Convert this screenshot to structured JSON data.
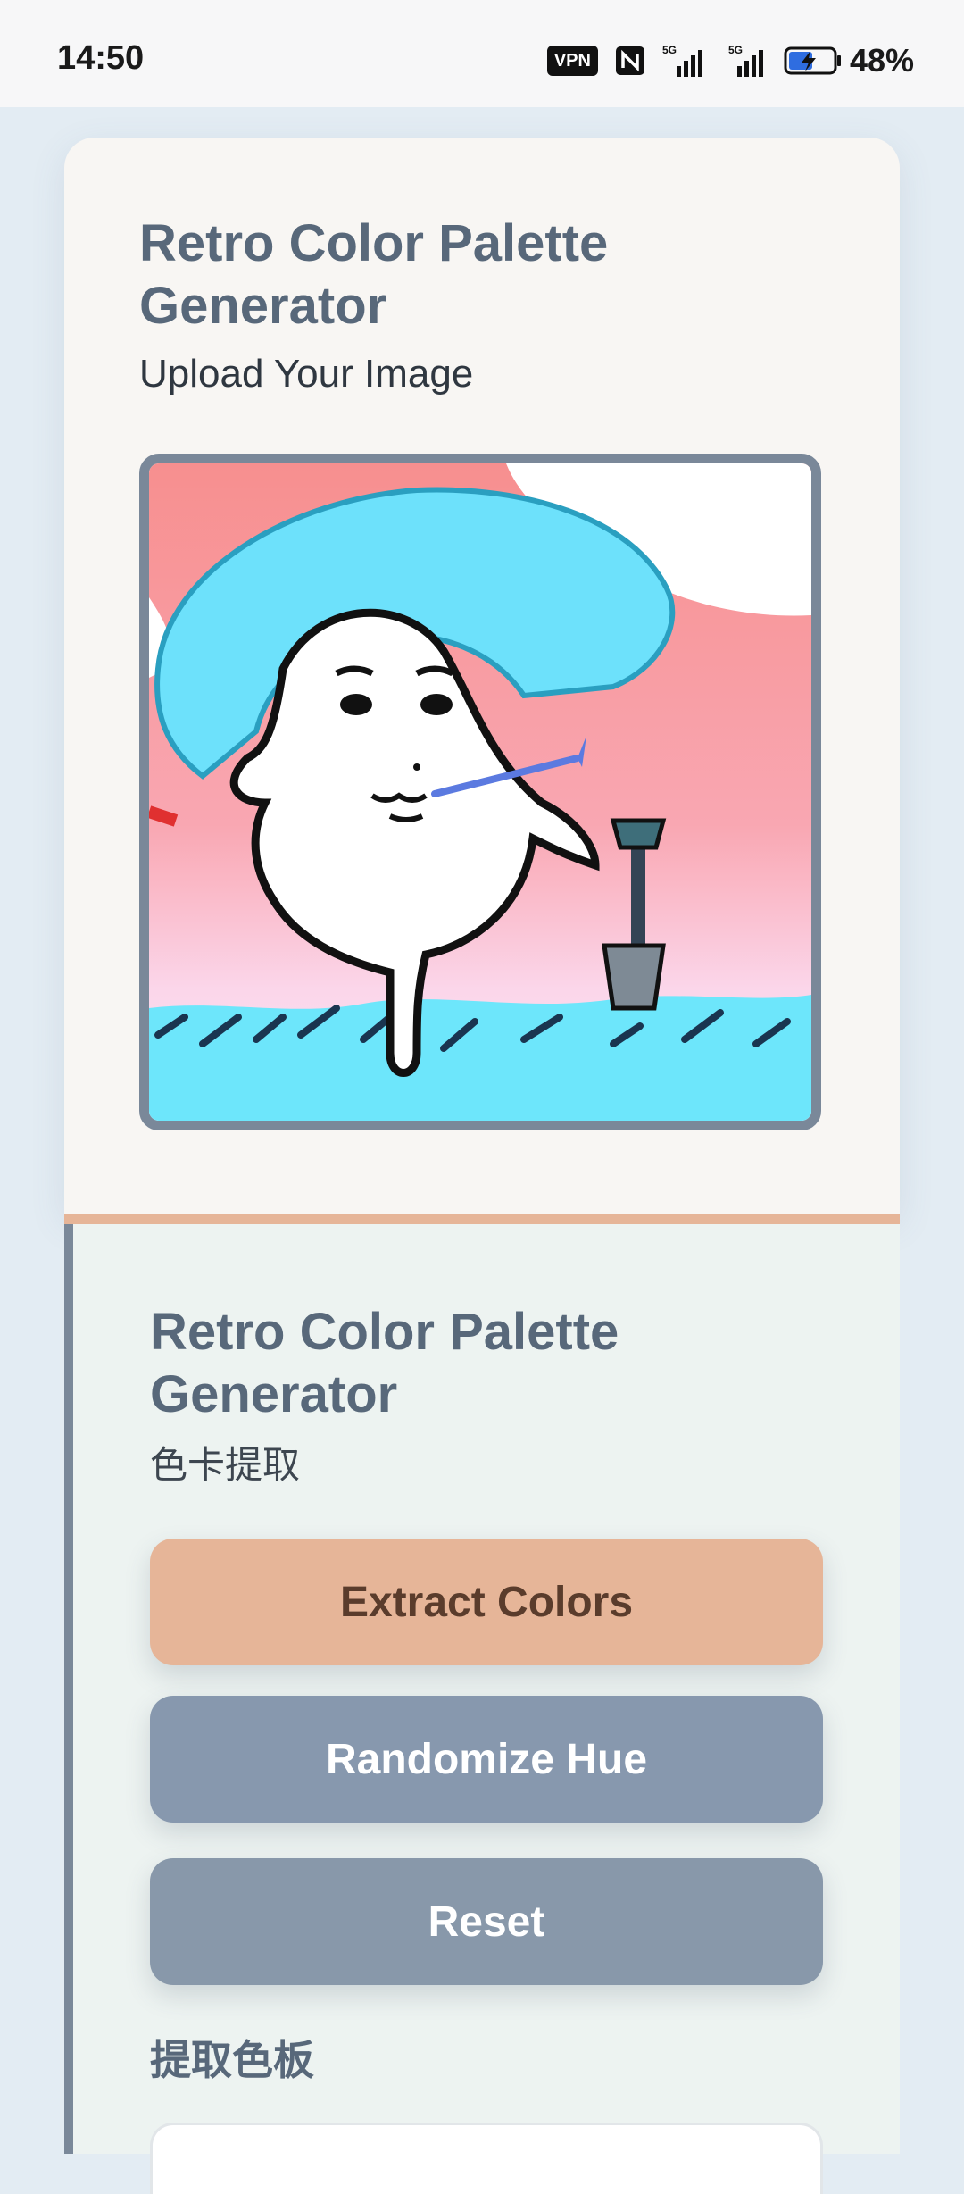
{
  "status_bar": {
    "time": "14:50",
    "vpn": "VPN",
    "battery": "48%",
    "icons": [
      "vpn-icon",
      "nfc-icon",
      "signal-5g-icon",
      "signal-5g-icon",
      "battery-charging-icon"
    ]
  },
  "upload_card": {
    "title": "Retro Color Palette Generator",
    "subtitle": "Upload Your Image",
    "image": "uploaded-image"
  },
  "palette_card": {
    "title": "Retro Color Palette Generator",
    "subtitle": "色卡提取",
    "buttons": {
      "extract": "Extract Colors",
      "randomize": "Randomize Hue",
      "reset": "Reset"
    },
    "palette_label": "提取色板"
  },
  "colors": {
    "accent": "#e6b598",
    "slate": "#8798ae",
    "title_color": "#58687a"
  }
}
